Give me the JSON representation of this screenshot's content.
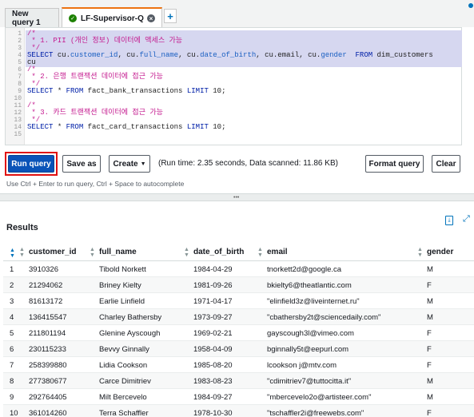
{
  "tabs": [
    {
      "label": "New query 1",
      "active": false
    },
    {
      "label": "LF-Supervisor-Q...",
      "active": true
    }
  ],
  "tab_add_label": "+",
  "editor": {
    "line_numbers": [
      "1",
      "2",
      "3",
      "4",
      "5",
      "6",
      "7",
      "8",
      "9",
      "10",
      "11",
      "12",
      "13",
      "14",
      "15"
    ],
    "lines": [
      [
        {
          "t": "/*",
          "c": "cmt"
        }
      ],
      [
        {
          "t": " * 1. PII (개인 정보) 데이터에 액세스 가능",
          "c": "cmt"
        }
      ],
      [
        {
          "t": " */",
          "c": "cmt"
        }
      ],
      [
        {
          "t": "SELECT ",
          "c": "kw"
        },
        {
          "t": "cu.",
          "c": "plain"
        },
        {
          "t": "customer_id",
          "c": "fld"
        },
        {
          "t": ", cu.",
          "c": "plain"
        },
        {
          "t": "full_name",
          "c": "fld"
        },
        {
          "t": ", cu.",
          "c": "plain"
        },
        {
          "t": "date_of_birth",
          "c": "fld"
        },
        {
          "t": ", cu.email, cu.",
          "c": "plain"
        },
        {
          "t": "gender",
          "c": "fld"
        },
        {
          "t": "  FROM ",
          "c": "kw"
        },
        {
          "t": "dim_customers",
          "c": "plain"
        }
      ],
      [
        {
          "t": "cu",
          "c": "plain"
        }
      ],
      [
        {
          "t": "/*",
          "c": "cmt"
        }
      ],
      [
        {
          "t": " * 2. 은행 트랜잭션 데이터에 접근 가능",
          "c": "cmt"
        }
      ],
      [
        {
          "t": " */",
          "c": "cmt"
        }
      ],
      [
        {
          "t": "SELECT ",
          "c": "kw"
        },
        {
          "t": "* ",
          "c": "plain"
        },
        {
          "t": "FROM ",
          "c": "kw"
        },
        {
          "t": "fact_bank_transactions ",
          "c": "plain"
        },
        {
          "t": "LIMIT ",
          "c": "kw"
        },
        {
          "t": "10;",
          "c": "plain"
        }
      ],
      [],
      [
        {
          "t": "/*",
          "c": "cmt"
        }
      ],
      [
        {
          "t": " * 3. 카드 트랜잭션 데이터에 접근 가능",
          "c": "cmt"
        }
      ],
      [
        {
          "t": " */",
          "c": "cmt"
        }
      ],
      [
        {
          "t": "SELECT ",
          "c": "kw"
        },
        {
          "t": "* ",
          "c": "plain"
        },
        {
          "t": "FROM ",
          "c": "kw"
        },
        {
          "t": "fact_card_transactions ",
          "c": "plain"
        },
        {
          "t": "LIMIT ",
          "c": "kw"
        },
        {
          "t": "10;",
          "c": "plain"
        }
      ],
      []
    ]
  },
  "toolbar": {
    "run_label": "Run query",
    "save_label": "Save as",
    "create_label": "Create",
    "run_info": "(Run time: 2.35 seconds, Data scanned: 11.86 KB)",
    "format_label": "Format query",
    "clear_label": "Clear",
    "hint": "Use Ctrl + Enter to run query, Ctrl + Space to autocomplete"
  },
  "divider_grip": "•••",
  "results": {
    "title": "Results",
    "columns": [
      "",
      "customer_id",
      "full_name",
      "date_of_birth",
      "email",
      "gender"
    ],
    "rows": [
      [
        "1",
        "3910326",
        "Tibold Norkett",
        "1984-04-29",
        "tnorkett2d@google.ca",
        "M"
      ],
      [
        "2",
        "21294062",
        "Briney Kielty",
        "1981-09-26",
        "bkielty6@theatlantic.com",
        "F"
      ],
      [
        "3",
        "81613172",
        "Earlie Linfield",
        "1971-04-17",
        "\"elinfield3z@liveinternet.ru\"",
        "M"
      ],
      [
        "4",
        "136415547",
        "Charley Bathersby",
        "1973-09-27",
        "\"cbathersby2t@sciencedaily.com\"",
        "M"
      ],
      [
        "5",
        "211801194",
        "Glenine Ayscough",
        "1969-02-21",
        "gayscough3l@vimeo.com",
        "F"
      ],
      [
        "6",
        "230115233",
        "Bevvy Ginnally",
        "1958-04-09",
        "bginnally5t@eepurl.com",
        "F"
      ],
      [
        "7",
        "258399880",
        "Lidia Cookson",
        "1985-08-20",
        "lcookson j@mtv.com",
        "F"
      ],
      [
        "8",
        "277380677",
        "Carce Dimitriev",
        "1983-08-23",
        "\"cdimitriev7@tuttocitta.it\"",
        "M"
      ],
      [
        "9",
        "292764405",
        "Milt Bercevelo",
        "1984-09-27",
        "\"mbercevelo2o@artisteer.com\"",
        "M"
      ],
      [
        "10",
        "361014260",
        "Terra Schaffler",
        "1978-10-30",
        "\"tschaffler2i@freewebs.com\"",
        "F"
      ]
    ]
  },
  "colors": {
    "accent": "#0a53b8",
    "highlight": "#e01010",
    "tab_active": "#ec7211"
  }
}
